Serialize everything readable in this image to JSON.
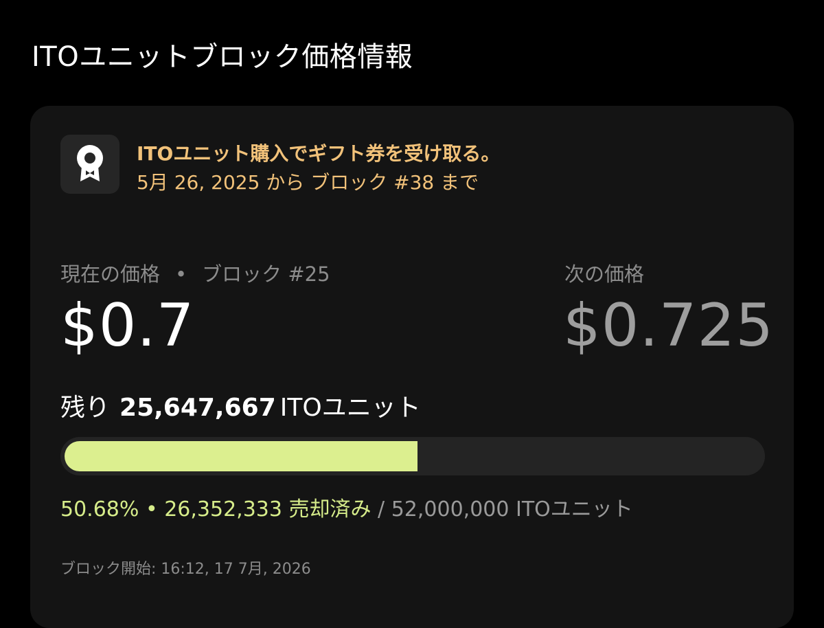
{
  "page": {
    "title": "ITOユニットブロック価格情報"
  },
  "promo": {
    "icon": "award-ribbon-icon",
    "title": "ITOユニット購入でギフト券を受け取る。",
    "subtitle": "5月 26, 2025 から ブロック #38 まで"
  },
  "current": {
    "label": "現在の価格",
    "separator": "•",
    "block": "ブロック #25",
    "price": "$0.7"
  },
  "next": {
    "label": "次の価格",
    "price": "$0.725"
  },
  "remaining": {
    "prefix": "残り",
    "amount": "25,647,667",
    "unit": "ITOユニット"
  },
  "progress": {
    "percent_value": 50.68,
    "percent_text": "50.68%",
    "separator": "•",
    "sold": "26,352,333 売却済み",
    "total": "/ 52,000,000 ITOユニット"
  },
  "block_start": "ブロック開始: 16:12, 17 7月, 2026",
  "colors": {
    "accent_gold": "#f2c27a",
    "progress_green": "#dcef8f",
    "background": "#000000",
    "card": "#141414"
  }
}
